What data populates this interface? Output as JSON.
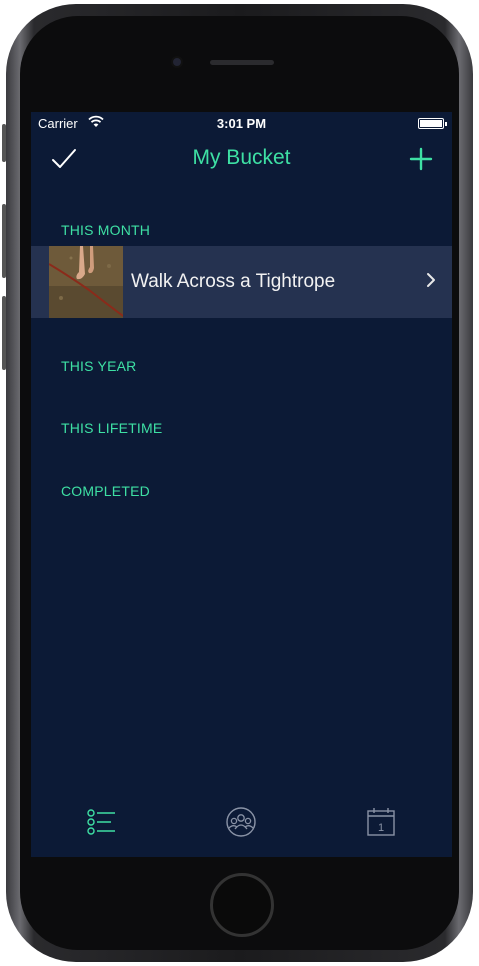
{
  "status_bar": {
    "carrier": "Carrier",
    "time": "3:01 PM",
    "wifi_icon": "wifi-icon",
    "battery_icon": "battery-icon"
  },
  "nav": {
    "title": "My Bucket",
    "left_icon": "checkmark-icon",
    "right_icon": "plus-icon"
  },
  "sections": {
    "this_month": "THIS MONTH",
    "this_year": "THIS YEAR",
    "this_lifetime": "THIS LIFETIME",
    "completed": "COMPLETED"
  },
  "items": [
    {
      "title": "Walk Across a Tightrope",
      "thumbnail": "tightrope-feet-photo",
      "accessory": "chevron-right-icon"
    }
  ],
  "tabs": [
    {
      "icon": "list-icon",
      "selected": true
    },
    {
      "icon": "group-icon",
      "selected": false
    },
    {
      "icon": "calendar-icon",
      "selected": false,
      "calendar_day": "1"
    }
  ],
  "colors": {
    "accent": "#3ee0a4",
    "background": "#0c1a36",
    "row_background": "#253250",
    "inactive_icon": "#8a93a6"
  }
}
